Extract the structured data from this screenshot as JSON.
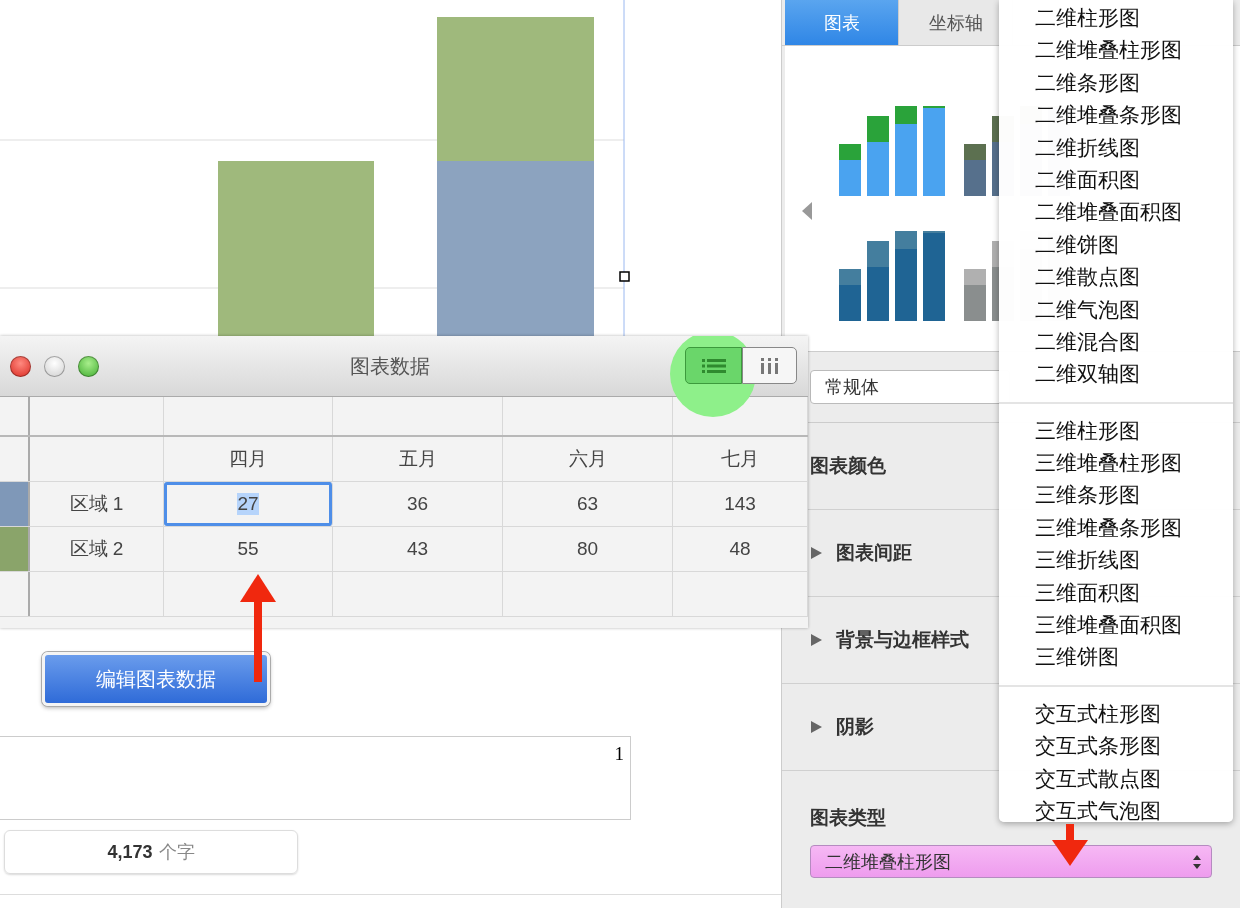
{
  "data_window": {
    "title": "图表数据",
    "view_toggle": [
      {
        "kind": "list",
        "selected": true
      },
      {
        "kind": "columns",
        "selected": false
      }
    ],
    "columns": [
      "四月",
      "五月",
      "六月",
      "七月"
    ],
    "rows": [
      {
        "label": "区域 1",
        "color": "#7f98b8",
        "cells": [
          {
            "value": "27",
            "selected": true
          },
          {
            "value": "36",
            "selected": false
          },
          {
            "value": "63",
            "selected": false
          },
          {
            "value": "143",
            "selected": false
          }
        ]
      },
      {
        "label": "区域 2",
        "color": "#8aa46a",
        "cells": [
          {
            "value": "55",
            "selected": false
          },
          {
            "value": "43",
            "selected": false
          },
          {
            "value": "80",
            "selected": false
          },
          {
            "value": "48",
            "selected": false
          }
        ]
      }
    ]
  },
  "edit_button": "编辑图表数据",
  "page_number": "1",
  "word_count": "**4,173** 个字",
  "inspector": {
    "tabs": [
      {
        "label": "图表",
        "selected": true
      },
      {
        "label": "坐标轴",
        "selected": false
      }
    ],
    "font_style": "常规体",
    "sections": [
      {
        "label": "图表颜色",
        "kind": "heading"
      },
      {
        "label": "图表间距",
        "kind": "disclosure",
        "expanded": false
      },
      {
        "label": "背景与边框样式",
        "kind": "disclosure",
        "expanded": false
      },
      {
        "label": "阴影",
        "kind": "disclosure",
        "expanded": false
      }
    ],
    "chart_type_label": "图表类型",
    "chart_type": "二维堆叠柱形图"
  },
  "chart_type_menu": {
    "groups": [
      {
        "items": [
          "二维柱形图",
          "二维堆叠柱形图",
          "二维条形图",
          "二维堆叠条形图",
          "二维折线图",
          "二维面积图",
          "二维堆叠面积图",
          "二维饼图",
          "二维散点图",
          "二维气泡图",
          "二维混合图",
          "二维双轴图"
        ]
      },
      {
        "items": [
          "三维柱形图",
          "三维堆叠柱形图",
          "三维条形图",
          "三维堆叠条形图",
          "三维折线图",
          "三维面积图",
          "三维堆叠面积图",
          "三维饼图"
        ]
      },
      {
        "items": [
          "交互式柱形图",
          "交互式条形图",
          "交互式散点图",
          "交互式气泡图"
        ]
      }
    ]
  }
}
